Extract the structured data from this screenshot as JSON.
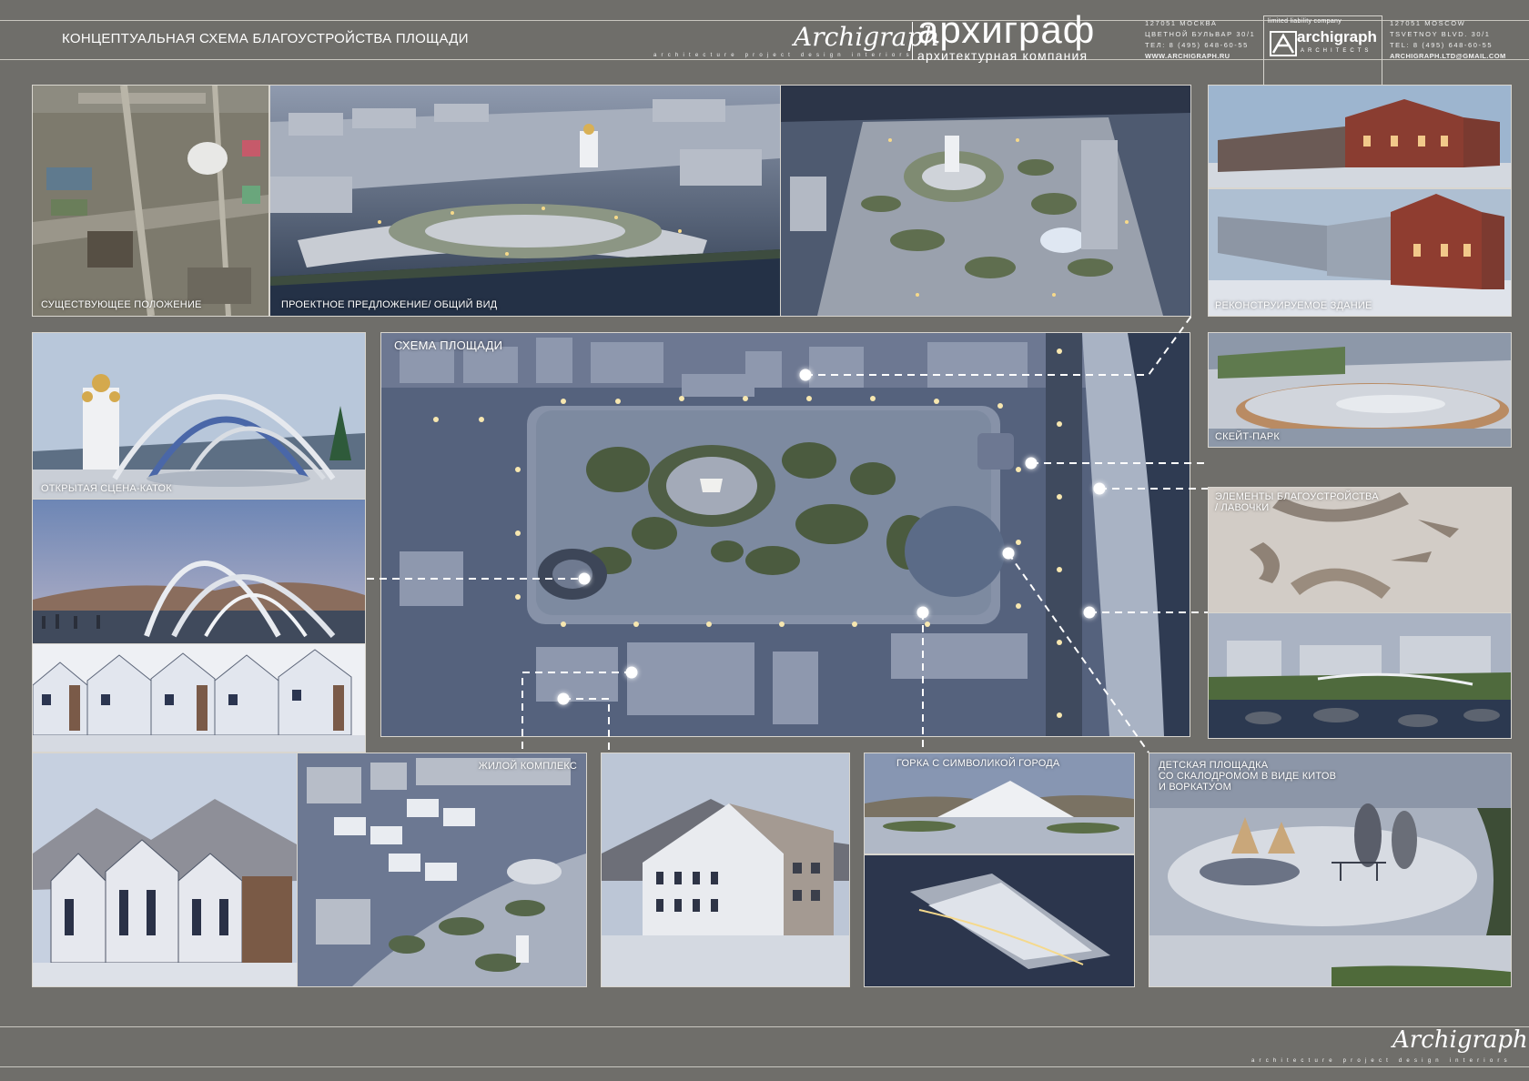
{
  "header": {
    "title": "КОНЦЕПТУАЛЬНАЯ СХЕМА БЛАГОУСТРОЙСТВА ПЛОЩАДИ",
    "signature": "Archigraph",
    "tagline": "architecture  project  design  interiors",
    "brand": "архиграф",
    "brand_sub": "архитектурная компания",
    "address_ru": [
      "127051 МОСКВА",
      "ЦВЕТНОЙ БУЛЬВАР 30/1",
      "ТЕЛ: 8 (495) 648-60-55",
      "WWW.ARCHIGRAPH.RU"
    ],
    "logo_top": "limited liability company",
    "logo_word": "archigraph",
    "logo_arch": "ARCHITECTS",
    "address_en": [
      "127051 MOSCOW",
      "TSVETNOY BLVD. 30/1",
      "TEL: 8 (495) 648-60-55",
      "ARCHIGRAPH.LTD@GMAIL.COM"
    ]
  },
  "labels": {
    "existing": "СУЩЕСТВУЮЩЕЕ ПОЛОЖЕНИЕ",
    "proposal": "ПРОЕКТНОЕ ПРЕДЛОЖЕНИЕ/ ОБЩИЙ ВИД",
    "reconstructed": "РЕКОНСТРУИРУЕМОЕ ЗДАНИЕ",
    "scheme": "СХЕМА ПЛОЩАДИ",
    "stage": "ОТКРЫТАЯ СЦЕНА-КАТОК",
    "skate": "СКЕЙТ-ПАРК",
    "elements_1": "ЭЛЕМЕНТЫ БЛАГОУСТРОЙСТВА",
    "elements_2": "/ ЛАВОЧКИ",
    "residential": "ЖИЛОЙ КОМПЛЕКС",
    "hill": "ГОРКА С СИМВОЛИКОЙ ГОРОДА",
    "playground_1": "ДЕТСКАЯ ПЛОЩАДКА",
    "playground_2": "СО СКАЛОДРОМОМ В ВИДЕ КИТОВ",
    "playground_3": "И ВОРКАТУОМ"
  },
  "footer": {
    "signature": "Archigraph",
    "tagline": "architecture  project  design  interiors"
  },
  "colors": {
    "background": "#6f6e6a",
    "night_blue": "#3d4a63",
    "snow": "#d9dde6",
    "glow": "#f5e6b8"
  }
}
